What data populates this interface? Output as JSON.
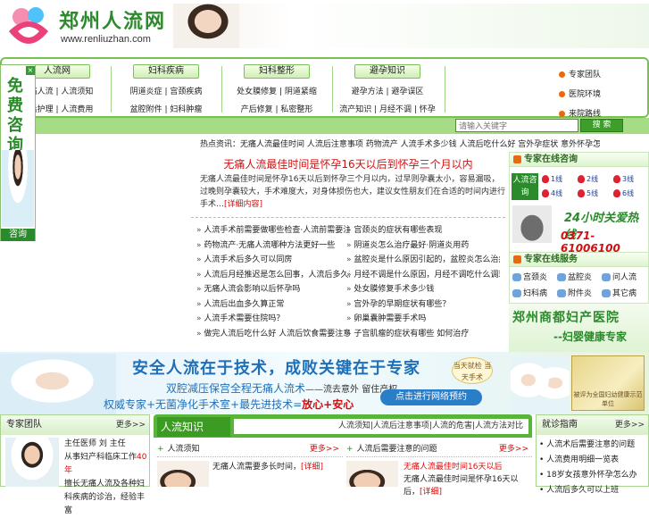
{
  "header": {
    "title": "郑州人流网",
    "url": "www.renliuzhan.com"
  },
  "nav": {
    "columns": [
      {
        "head": "人流网",
        "row1": "无痛人流 | 人流须知",
        "row2": "术后护理 | 人流费用"
      },
      {
        "head": "妇科疾病",
        "row1": "阴道炎症 | 宫颈疾病",
        "row2": "盆腔附件 | 妇科肿瘤"
      },
      {
        "head": "妇科整形",
        "row1": "处女膜修复 | 阴道紧缩",
        "row2": "产后修复 | 私密整形"
      },
      {
        "head": "避孕知识",
        "row1": "避孕方法 | 避孕误区",
        "row2": "流产知识 | 月经不调 | 怀孕"
      }
    ],
    "right_links": [
      "专家团队",
      "医院环境",
      "来院路线"
    ]
  },
  "search": {
    "placeholder": "请输入关键字",
    "button": "搜 索"
  },
  "float_consult": {
    "close": "×",
    "text": "免费咨询",
    "label": "咨询"
  },
  "ticker": "热点资讯：无痛人流最佳时间 人流后注意事项 药物流产 人流手术多少钱 人流后吃什么好 宫外孕症状 意外怀孕怎么办 人流术后护理 人流前注意事项 人流注意",
  "headline": "无痛人流最佳时间是怀孕16天以后到怀孕三个月以内",
  "summary": {
    "text": "无痛人流最佳时间是怀孕16天以后到怀孕三个月以内，过早则孕囊太小，容易漏吸，过晚则孕囊较大，手术难度大，对身体损伤也大，建议女性朋友们在合适的时间内进行手术",
    "more": "[详细内容]"
  },
  "list_left": [
    "人流手术前需要做哪些检查·人流前需要注意什么",
    "药物流产·无痛人流哪种方法更好一些",
    "人流手术后多久可以同房",
    "人流后月经推迟是怎么回事，人流后多久来月经正常？",
    "无痛人流会影响以后怀孕吗",
    "人流后出血多久算正常",
    "人流手术需要住院吗？",
    "做完人流后吃什么好 人流后饮食需要注意哪些事项"
  ],
  "list_right": [
    "宫颈炎的症状有哪些表现",
    "阴道炎怎么治疗最好·阴道炎用药",
    "盆腔炎是什么原因引起的，盆腔炎怎么治疗好？",
    "月经不调是什么原因，月经不调吃什么调理好？",
    "处女膜修复手术多少钱",
    "宫外孕的早期症状有哪些？",
    "卵巢囊肿需要手术吗",
    "子宫肌瘤的症状有哪些 如何治疗"
  ],
  "experts": {
    "title": "专家在线咨询",
    "badge": "人流咨询",
    "qq": [
      "1线",
      "2线",
      "3线",
      "4线",
      "5线",
      "6线"
    ],
    "hotline_title": "24小时关爱热线",
    "hotline_number": "0371-61006100"
  },
  "services": {
    "title": "专家在线服务",
    "items": [
      "宫颈炎",
      "盆腔炎",
      "问人流",
      "妇科病",
      "附件炎",
      "其它病"
    ]
  },
  "hospital": {
    "name": "郑州商都妇产医院",
    "slogan": "--妇婴健康专家"
  },
  "banner": {
    "line1": "安全人流在于技术，成败关键在于专家",
    "line2": "双腔减压保宫全程无痛人流术",
    "line2_tail": "——流去意外 留住产权",
    "line3_a": "权威专家+无菌净化手术室+最先进技术=",
    "line3_b": "放心+安心",
    "badge": "当天就检 当天手术",
    "button": "点击进行网络预约",
    "cert": "被评为全国妇幼健康示范单位"
  },
  "bottom_left": {
    "title": "专家团队",
    "more": "更多>>",
    "doctor": "主任医师 刘 主任",
    "years": "从事妇产科临床工作",
    "years_num": "40年",
    "desc": "擅长无痛人流及各种妇科疾病的诊治，经验丰富"
  },
  "bottom_mid": {
    "tab": "人流知识",
    "links": "人流须知|人流后注意事项|人流的危害|人流方法对比",
    "col1_title": "人流须知",
    "col2_title": "人流后需要注意的问题",
    "more": "更多>>",
    "item1": "无痛人流需要多长时间，",
    "item1_more": "[详细]",
    "item2_title": "无痛人流最佳时间16天以后",
    "item2": "无痛人流最佳时间是怀孕16天以后，",
    "item2_more": "[详细]"
  },
  "bottom_right": {
    "title": "就诊指南",
    "more": "更多>>",
    "items": [
      "人流术后需要注意的问题",
      "人流费用明细一览表",
      "18岁女孩意外怀孕怎么办",
      "人流后多久可以上班"
    ]
  }
}
